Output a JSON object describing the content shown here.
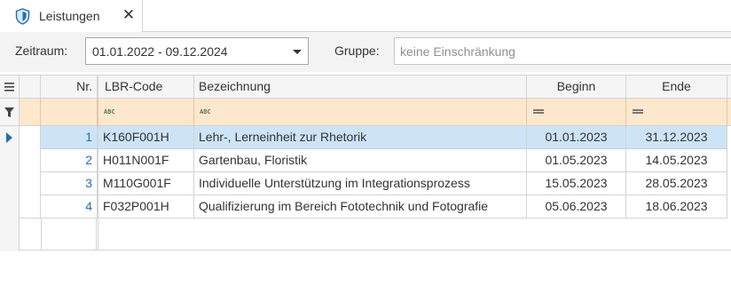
{
  "tab": {
    "title": "Leistungen",
    "icon": "shield-icon",
    "close_glyph": "✕"
  },
  "filters": {
    "zeitraum_label": "Zeitraum:",
    "zeitraum_value": "01.01.2022 - 09.12.2024",
    "gruppe_label": "Gruppe:",
    "gruppe_placeholder": "keine Einschränkung"
  },
  "grid": {
    "columns": [
      {
        "key": "nr",
        "label": "Nr."
      },
      {
        "key": "lbr_code",
        "label": "LBR-Code"
      },
      {
        "key": "bezeichnung",
        "label": "Bezeichnung"
      },
      {
        "key": "beginn",
        "label": "Beginn"
      },
      {
        "key": "ende",
        "label": "Ende"
      }
    ],
    "filter_icons": {
      "text": "abc-filter-icon",
      "date": "equals-filter-icon"
    },
    "rows": [
      {
        "nr": "1",
        "lbr_code": "K160F001H",
        "bezeichnung": "Lehr-, Lerneinheit zur Rhetorik",
        "beginn": "01.01.2023",
        "ende": "31.12.2023",
        "selected": true
      },
      {
        "nr": "2",
        "lbr_code": "H011N001F",
        "bezeichnung": "Gartenbau, Floristik",
        "beginn": "01.05.2023",
        "ende": "14.05.2023"
      },
      {
        "nr": "3",
        "lbr_code": "M110G001F",
        "bezeichnung": "Individuelle Unterstützung im Integrationsprozess",
        "beginn": "15.05.2023",
        "ende": "28.05.2023"
      },
      {
        "nr": "4",
        "lbr_code": "F032P001H",
        "bezeichnung": "Qualifizierung im Bereich Fototechnik und Fotografie",
        "beginn": "05.06.2023",
        "ende": "18.06.2023"
      }
    ]
  },
  "colors": {
    "accent": "#1f6fb5",
    "selected_row": "#cde4f7",
    "filter_row": "#fde7cd"
  }
}
